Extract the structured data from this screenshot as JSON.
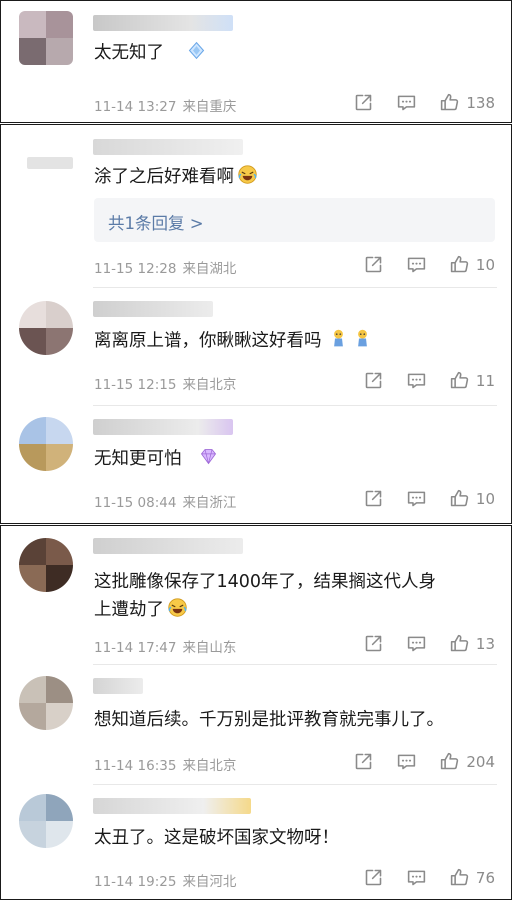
{
  "panels": [
    {
      "comments": [
        {
          "text": "太无知了",
          "date": "11-14 13:27",
          "location": "来自重庆",
          "likes": "138"
        }
      ]
    },
    {
      "comments": [
        {
          "text": "涂了之后好难看啊",
          "date": "11-15 12:28",
          "location": "来自湖北",
          "likes": "10",
          "reply_label": "共1条回复 >"
        },
        {
          "text": "离离原上谱，你瞅瞅这好看吗",
          "date": "11-15 12:15",
          "location": "来自北京",
          "likes": "11"
        },
        {
          "text": "无知更可怕",
          "date": "11-15 08:44",
          "location": "来自浙江",
          "likes": "10"
        }
      ]
    },
    {
      "comments": [
        {
          "text_line1": "这批雕像保存了1400年了，结果搁这代人身",
          "text_line2": "上遭劫了",
          "date": "11-14 17:47",
          "location": "来自山东",
          "likes": "13"
        },
        {
          "text": "想知道后续。千万别是批评教育就完事儿了。",
          "date": "11-14 16:35",
          "location": "来自北京",
          "likes": "204"
        },
        {
          "text": "太丑了。这是破坏国家文物呀！",
          "date": "11-14 19:25",
          "location": "来自河北",
          "likes": "76"
        }
      ]
    }
  ],
  "icons": {
    "share": "share-icon",
    "comment": "comment-icon",
    "like": "like-icon"
  },
  "colors": {
    "meta_text": "#9a9a9a",
    "icon": "#8a8a8a",
    "reply_link": "#5b7ba7",
    "reply_bg": "#f4f5f7"
  }
}
